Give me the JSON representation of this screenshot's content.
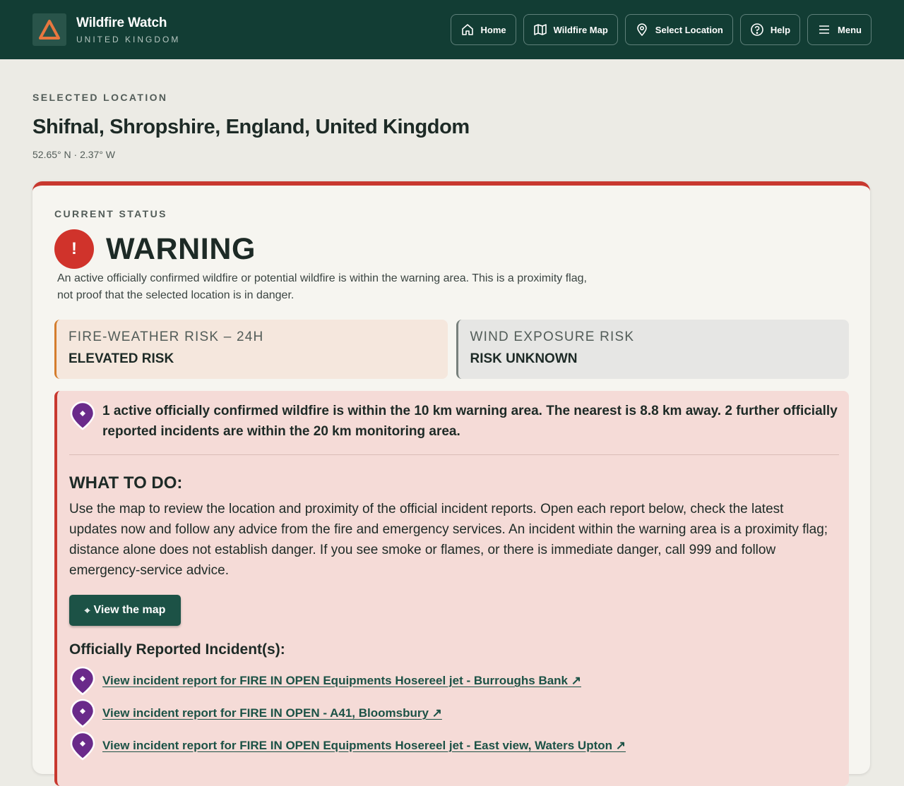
{
  "header": {
    "brand_title": "Wildfire Watch",
    "brand_subtitle": "UNITED KINGDOM",
    "nav": [
      {
        "label": "Home",
        "icon": "home-icon"
      },
      {
        "label": "Wildfire Map",
        "icon": "map-icon"
      },
      {
        "label": "Select Location",
        "icon": "location-pin-icon"
      },
      {
        "label": "Help",
        "icon": "help-icon"
      },
      {
        "label": "Menu",
        "icon": "hamburger-icon"
      }
    ]
  },
  "location": {
    "eyebrow": "SELECTED LOCATION",
    "name": "Shifnal, Shropshire, England, United Kingdom",
    "coords": "52.65° N · 2.37° W"
  },
  "status": {
    "eyebrow": "CURRENT STATUS",
    "level": "WARNING",
    "icon_glyph": "!",
    "description": "An active officially confirmed wildfire or potential wildfire is within the warning area. This is a proximity flag, not proof that the selected location is in danger."
  },
  "risks": {
    "fire": {
      "label": "FIRE-WEATHER RISK – 24H",
      "value": "ELEVATED RISK"
    },
    "wind": {
      "label": "WIND EXPOSURE RISK",
      "value": "RISK UNKNOWN"
    }
  },
  "alert": {
    "summary": "1 active officially confirmed wildfire is within the 10 km warning area. The nearest is 8.8 km away. 2 further officially reported incidents are within the 20 km monitoring area.",
    "todo_title": "WHAT TO DO:",
    "todo_body": "Use the map to review the location and proximity of the official incident reports. Open each report below, check the latest updates now and follow any advice from the fire and emergency services. An incident within the warning area is a proximity flag; distance alone does not establish danger. If you see smoke or flames, or there is immediate danger, call 999 and follow emergency-service advice.",
    "map_button": "View the map",
    "incidents_title": "Officially Reported Incident(s):",
    "incidents": [
      "View incident report for FIRE IN OPEN Equipments Hosereel jet - Burroughs Bank ↗",
      "View incident report for FIRE IN OPEN - A41, Bloomsbury ↗",
      "View incident report for FIRE IN OPEN Equipments Hosereel jet - East view, Waters Upton ↗"
    ]
  },
  "colors": {
    "header_bg": "#123d34",
    "warning_red": "#c8382f",
    "fire_accent": "#d47d2d",
    "pin_purple": "#6a2a8a",
    "button_green": "#1c5246"
  }
}
